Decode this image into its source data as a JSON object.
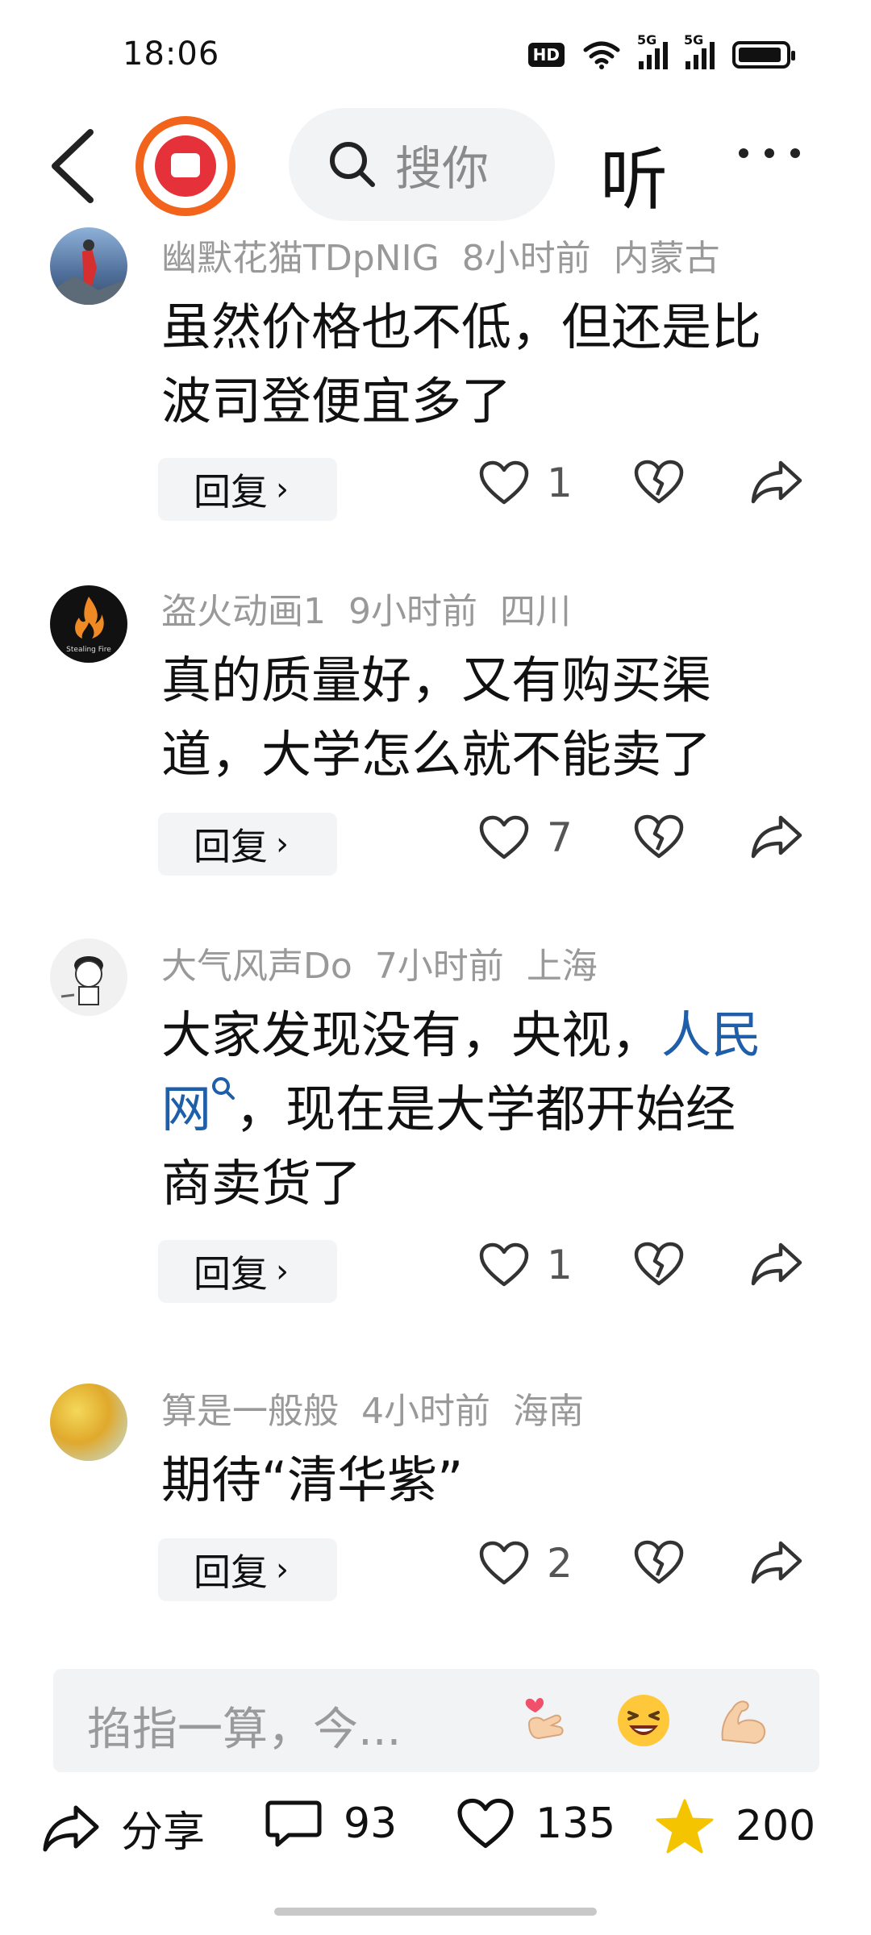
{
  "status_bar": {
    "time": "18:06",
    "hd_label": "HD",
    "network_1": "5G",
    "network_2": "5G"
  },
  "nav": {
    "search_placeholder": "搜你",
    "listen_label": "听"
  },
  "comments": [
    {
      "user": "幽默花猫TDpNIG",
      "time": "8小时前",
      "location": "内蒙古",
      "text_parts": [
        "虽然价格也不低，但还是比波司登便宜多了"
      ],
      "reply_label": "回复",
      "likes": "1",
      "avatar_color": "#6f8fb5"
    },
    {
      "user": "盗火动画1",
      "time": "9小时前",
      "location": "四川",
      "text_parts": [
        "真的质量好，又有购买渠道，大学怎么就不能卖了"
      ],
      "reply_label": "回复",
      "likes": "7",
      "avatar_color": "#111111",
      "avatar_text": "Stealing Fire"
    },
    {
      "user": "大气风声Do",
      "time": "7小时前",
      "location": "上海",
      "text_before": "大家发现没有，央视，",
      "text_link": "人民网",
      "text_after": "，现在是大学都开始经商卖货了",
      "reply_label": "回复",
      "likes": "1",
      "avatar_color": "#f0f0f0"
    },
    {
      "user": "算是一般般",
      "time": "4小时前",
      "location": "海南",
      "text_parts": [
        "期待“清华紫”"
      ],
      "reply_label": "回复",
      "likes": "2",
      "avatar_color": "#e8c84a"
    }
  ],
  "input": {
    "placeholder": "掐指一算，今..."
  },
  "bottom": {
    "share_label": "分享",
    "comment_count": "93",
    "like_count": "135",
    "favorite_count": "200"
  },
  "colors": {
    "accent_link": "#1f5ea8",
    "favorite_star": "#f5c400",
    "brand_orange": "#f2641c"
  }
}
